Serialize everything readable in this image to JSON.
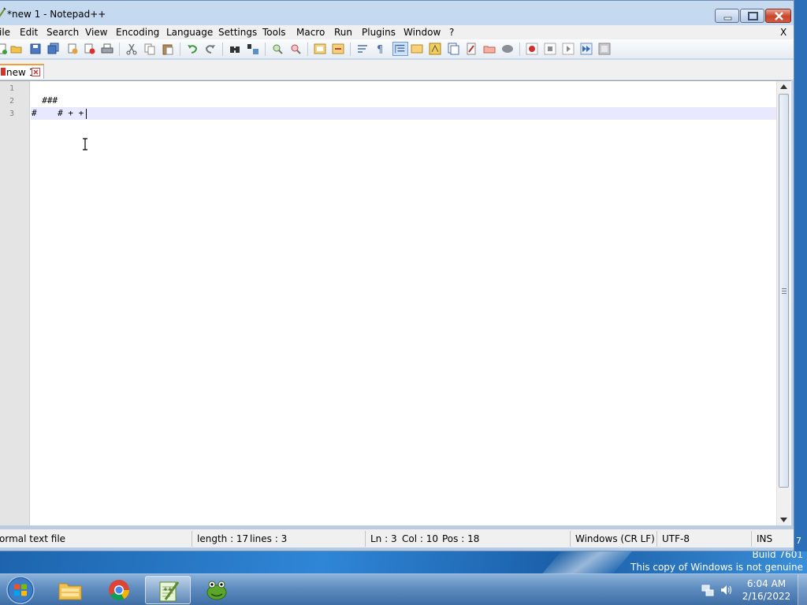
{
  "window": {
    "title": "*new 1 - Notepad++",
    "doc_close": "X"
  },
  "menu": {
    "items": [
      "ile",
      "Edit",
      "Search",
      "View",
      "Encoding",
      "Language",
      "Settings",
      "Tools",
      "Macro",
      "Run",
      "Plugins",
      "Window",
      "?"
    ]
  },
  "tabs": [
    {
      "label": "new 1",
      "modified": true
    }
  ],
  "editor": {
    "line_numbers": [
      "1",
      "2",
      "3"
    ],
    "lines": [
      "",
      "  ###",
      "#    # + +"
    ],
    "current_line": 3
  },
  "status": {
    "file_type": "ormal text file",
    "length": "length : 17",
    "lines": "lines : 3",
    "ln": "Ln : 3",
    "col": "Col : 10",
    "pos": "Pos : 18",
    "eol": "Windows (CR LF)",
    "encoding": "UTF-8",
    "mode": "INS"
  },
  "desktop": {
    "build": "Build 7601",
    "genuine": "This copy of Windows is not genuine",
    "edge_digit": "7"
  },
  "taskbar": {
    "time": "6:04 AM",
    "date": "2/16/2022",
    "apps": [
      "windows-explorer",
      "google-chrome",
      "notepad-plus-plus",
      "frog-app"
    ]
  },
  "colors": {
    "current_line_bg": "#e8e8ff",
    "tab_accent": "#f49e38",
    "close_button": "#c8452c"
  }
}
